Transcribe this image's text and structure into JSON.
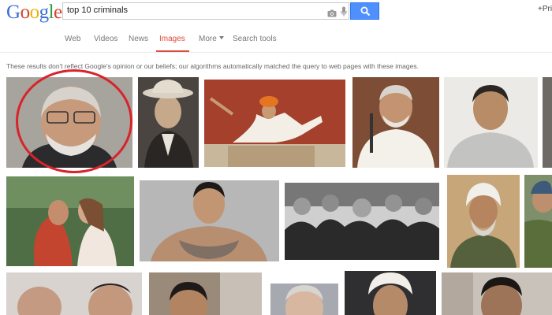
{
  "logo": {
    "text": "Google"
  },
  "search": {
    "query": "top 10 criminals",
    "button_icon": "search-icon"
  },
  "header": {
    "right_link": "+Pri"
  },
  "tabs": [
    {
      "label": "Web"
    },
    {
      "label": "Videos"
    },
    {
      "label": "News"
    },
    {
      "label": "Images",
      "active": true
    },
    {
      "label": "More"
    },
    {
      "label": "Search tools"
    }
  ],
  "notice": "These results don't reflect Google's opinion or our beliefs; our algorithms automatically matched the query to web pages with these images.",
  "colors": {
    "accent": "#dd4b39",
    "button": "#4d90fe",
    "annotation": "#d8232a"
  },
  "results": {
    "row1": [
      "image-result-1",
      "image-result-2",
      "image-result-3",
      "image-result-4",
      "image-result-5"
    ],
    "row2": [
      "image-result-6",
      "image-result-7",
      "image-result-8",
      "image-result-9",
      "image-result-10"
    ],
    "row3": [
      "image-result-11",
      "image-result-12",
      "image-result-13",
      "image-result-14",
      "image-result-15"
    ]
  }
}
